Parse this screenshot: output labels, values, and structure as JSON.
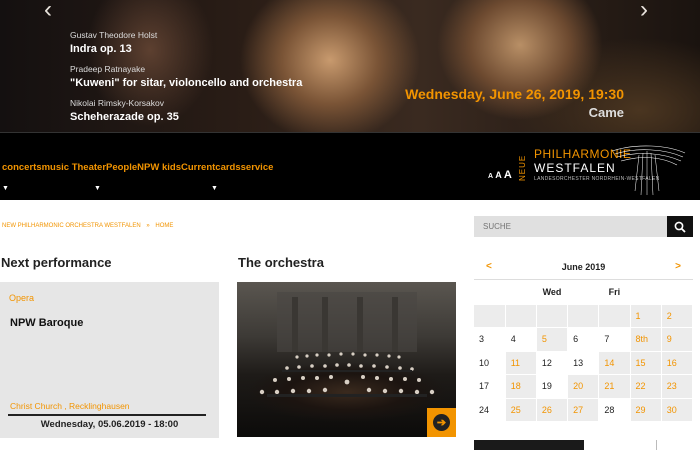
{
  "hero": {
    "program": [
      {
        "composer": "Gustav Theodore Holst",
        "work": "Indra op. 13"
      },
      {
        "composer": "Pradeep Ratnayake",
        "work": "\"Kuweni\" for sitar, violoncello and orchestra"
      },
      {
        "composer": "Nikolai Rimsky-Korsakov",
        "work": "Scheherazade op. 35"
      }
    ],
    "date": "Wednesday, June 26, 2019, 19:30",
    "venue": "Came",
    "prev_icon": "chevron-left-icon",
    "next_icon": "chevron-right-icon"
  },
  "nav": {
    "menu_text": "concertsmusic TheaterPeopleNPW kidsCurrentcardsservice",
    "font_size_label_small": "A",
    "font_size_label_medium": "A",
    "font_size_label_large": "A",
    "logo": {
      "line1": "PHILHARMONIE",
      "line2": "WESTFALEN",
      "line3": "LANDESORCHESTER NORDRHEIN-WESTFALEN",
      "prefix": "NEUE"
    }
  },
  "breadcrumb": {
    "items": [
      "NEW PHILHARMONIC ORCHESTRA WESTFALEN",
      "HOME"
    ],
    "separator": "»"
  },
  "next_performance": {
    "heading": "Next performance",
    "category": "Opera",
    "title": "NPW Baroque",
    "venue": "Christ Church , Recklinghausen",
    "datetime": "Wednesday, 05.06.2019 - 18:00"
  },
  "orchestra": {
    "heading": "The orchestra",
    "arrow_icon": "arrow-right-circle-icon"
  },
  "search": {
    "placeholder": "SUCHE",
    "icon": "search-icon"
  },
  "calendar": {
    "prev": "<",
    "next": ">",
    "month": "June 2019",
    "weekday_headers": [
      "",
      "",
      "Wed",
      "",
      "Fri",
      "",
      ""
    ],
    "weeks": [
      [
        "",
        "",
        "",
        "",
        "",
        "1",
        "2"
      ],
      [
        "3",
        "4",
        "5",
        "6",
        "7",
        "8th",
        "9"
      ],
      [
        "10",
        "11",
        "12",
        "13",
        "14",
        "15",
        "16"
      ],
      [
        "17",
        "18",
        "19",
        "20",
        "21",
        "22",
        "23"
      ],
      [
        "24",
        "25",
        "26",
        "27",
        "28",
        "29",
        "30"
      ]
    ]
  },
  "colors": {
    "accent": "#f29400",
    "dark": "#000000",
    "cell_bg": "#ececec"
  }
}
